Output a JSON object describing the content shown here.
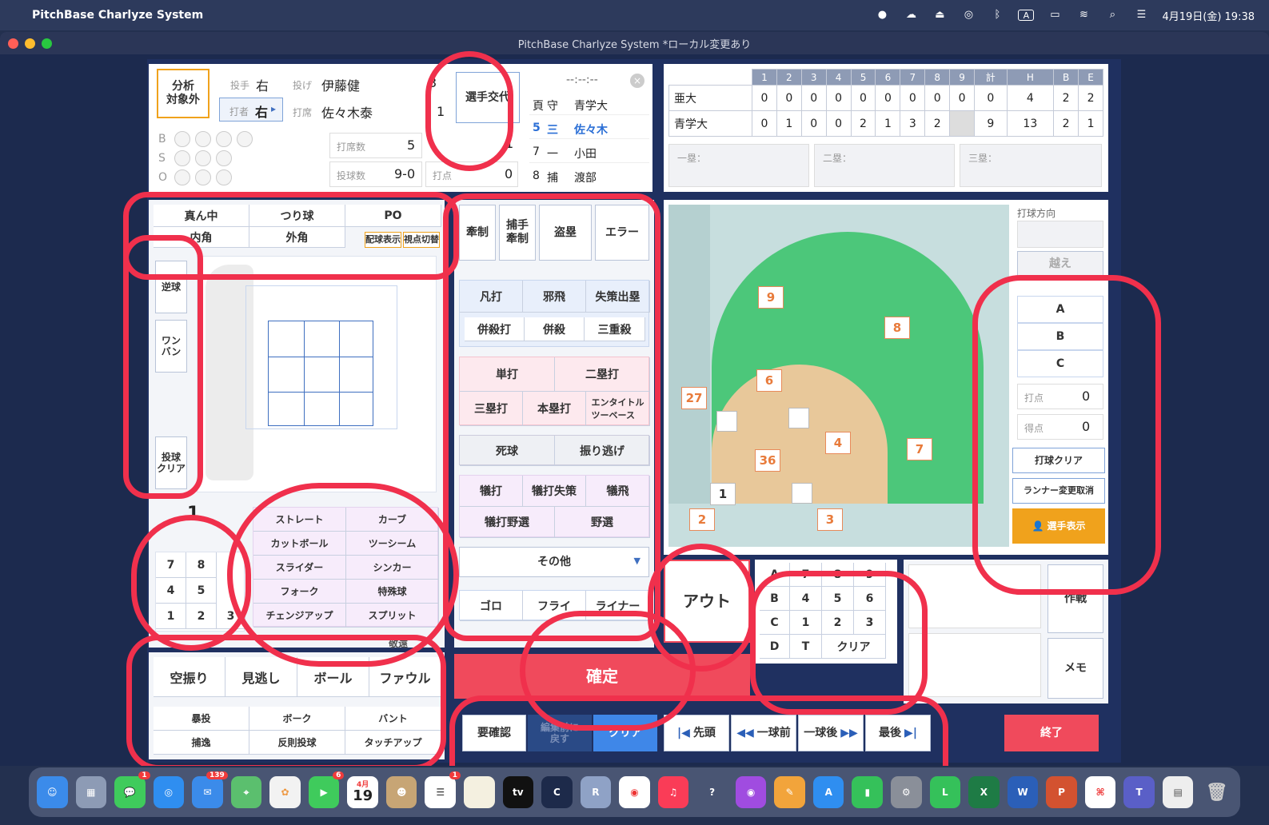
{
  "menubar": {
    "app_name": "PitchBase Charlyze System",
    "datetime": "4月19日(金)  19:38"
  },
  "window": {
    "title": "PitchBase Charlyze System *ローカル変更あり"
  },
  "pitcher_panel": {
    "exclude_label": "分析\n対象外",
    "pitcher_label": "投手",
    "pitcher_hand": "右",
    "throws_label": "投げ",
    "pitcher_name": "伊藤健",
    "pitcher_number": "3",
    "batter_label": "打者",
    "batter_hand": "右",
    "bats_label": "打席",
    "batter_name": "佐々木泰",
    "batter_number": "1",
    "substitution_button": "選手交代",
    "time_display": "--:--:--",
    "count_b": "B",
    "count_s": "S",
    "count_o": "O",
    "at_bats_label": "打席数",
    "at_bats_value": "5",
    "pitches_label": "投球数",
    "pitches_value": "9-0",
    "rbi_label": "打点",
    "rbi_value": "0",
    "hits_value": "1"
  },
  "lineup": {
    "rows": [
      {
        "num": "頁",
        "pos": "守",
        "name": "青学大"
      },
      {
        "num": "5",
        "pos": "三",
        "name": "佐々木"
      },
      {
        "num": "7",
        "pos": "一",
        "name": "小田"
      },
      {
        "num": "8",
        "pos": "捕",
        "name": "渡部"
      }
    ]
  },
  "scoreboard": {
    "headers": [
      "1",
      "2",
      "3",
      "4",
      "5",
      "6",
      "7",
      "8",
      "9",
      "計",
      "H",
      "B",
      "E"
    ],
    "rows": [
      {
        "team": "亜大",
        "scores": [
          "0",
          "0",
          "0",
          "0",
          "0",
          "0",
          "0",
          "0",
          "0",
          "0",
          "4",
          "2",
          "2"
        ]
      },
      {
        "team": "青学大",
        "scores": [
          "0",
          "1",
          "0",
          "0",
          "2",
          "1",
          "3",
          "2",
          "",
          "9",
          "13",
          "2",
          "1"
        ]
      }
    ],
    "bases": [
      "一塁：",
      "二塁：",
      "三塁："
    ]
  },
  "location": {
    "top_buttons": [
      "真ん中",
      "つり球",
      "PO"
    ],
    "second_row": [
      "内角",
      "外角"
    ],
    "small_buttons": [
      "配球表示",
      "視点切替"
    ],
    "side_buttons": [
      "逆球",
      "ワン\nバン",
      "投球\nクリア"
    ],
    "count_label": "1"
  },
  "numpad_left": {
    "keys": [
      "7",
      "8",
      "4",
      "5",
      "1",
      "2",
      "3"
    ]
  },
  "pitch_types": {
    "items": [
      "ストレート",
      "カーブ",
      "カットボール",
      "ツーシーム",
      "スライダー",
      "シンカー",
      "フォーク",
      "特殊球",
      "チェンジアップ",
      "スプリット"
    ],
    "hidden_label": "敬遠"
  },
  "pitch_result": {
    "main": [
      "空振り",
      "見逃し",
      "ボール",
      "ファウル"
    ],
    "sub": [
      "暴投",
      "ボーク",
      "バント",
      "捕逸",
      "反則投球",
      "タッチアップ"
    ]
  },
  "play_buttons": {
    "row1": [
      "牽制",
      "捕手\n牽制",
      "盗塁",
      "エラー"
    ],
    "outs": [
      "凡打",
      "邪飛",
      "失策出塁"
    ],
    "double": [
      "併殺打",
      "併殺",
      "三重殺"
    ],
    "hits": [
      "単打",
      "二塁打",
      "三塁打",
      "本塁打",
      "エンタイトル\nツーベース"
    ],
    "walks": [
      "死球",
      "振り逃げ"
    ],
    "sacrifice": [
      "犠打",
      "犠打失策",
      "犠飛",
      "犠打野選",
      "野選"
    ],
    "other": "その他",
    "ball_type": [
      "ゴロ",
      "フライ",
      "ライナー"
    ]
  },
  "field": {
    "positions": [
      "9",
      "8",
      "6",
      "27",
      "4",
      "7",
      "36",
      "1",
      "2",
      "3"
    ],
    "direction_label": "打球方向",
    "over_label": "越え",
    "abc": [
      "A",
      "B",
      "C"
    ],
    "rbi_label": "打点",
    "rbi_value": "0",
    "runs_label": "得点",
    "runs_value": "0",
    "clear_button": "打球クリア",
    "cancel_runner_button": "ランナー変更取消",
    "show_players_button": "選手表示"
  },
  "out_button": "アウト",
  "numpad_right": {
    "keys": [
      "A",
      "7",
      "8",
      "9",
      "B",
      "4",
      "5",
      "6",
      "C",
      "1",
      "2",
      "3",
      "D",
      "T",
      "クリア"
    ]
  },
  "strategy_button": "作戦",
  "memo_button": "メモ",
  "confirm_button": "確定",
  "footer": {
    "confirm_needed": "要確認",
    "revert": "編集前に\n戻す",
    "clear": "クリア",
    "first": "先頭",
    "prev": "一球前",
    "next": "一球後",
    "last": "最後",
    "end": "終了"
  },
  "colors": {
    "accent_red": "#f04a5c",
    "annotation_red": "#f0304c",
    "field_green": "#4cc77a",
    "infield_tan": "#e8c89a",
    "orange": "#f0a21c",
    "blue_button": "#3f87e8"
  },
  "dock": {
    "calendar_month": "4月",
    "calendar_day": "19",
    "mail_badge": "139",
    "facetime_badge": "6",
    "messages_badge": "1",
    "reminders_badge": "1"
  }
}
